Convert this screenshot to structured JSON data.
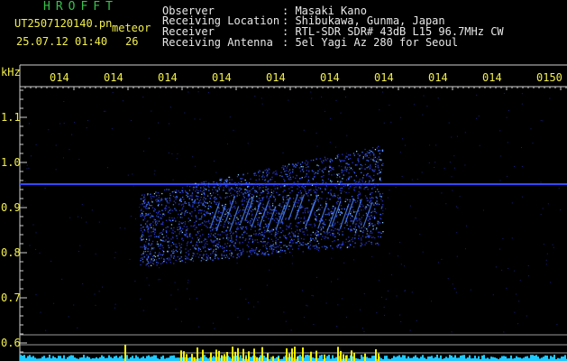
{
  "header": {
    "brand": "HROFFT",
    "filename": "UT2507120140.pn",
    "program_tag": "meteor",
    "timestamp": "25.07.12 01:40",
    "count": "26",
    "info_labels": [
      "Observer",
      "Receiving Location",
      "Receiver",
      "Receiving Antenna"
    ],
    "info_values": [
      ": Masaki Kano",
      ": Shibukawa, Gunma, Japan",
      ": RTL-SDR SDR# 43dB L15 96.7MHz CW",
      ": 5el Yagi Az 280 for Seoul"
    ]
  },
  "axes": {
    "y_unit": "kHz",
    "y_ticks": [
      "1.1",
      "1.0",
      "0.9",
      "0.8",
      "0.7",
      "0.6"
    ],
    "time_ticks": [
      "014",
      "014",
      "014",
      "014",
      "014",
      "014",
      "014",
      "014",
      "014",
      "0150"
    ]
  },
  "colors": {
    "background": "#000000",
    "text_white": "#e8e8e8",
    "text_yellow": "#f2ef4a",
    "brand_green": "#36c24a",
    "carrier": "#3348ff",
    "signal": "#3a6bff",
    "baseline_cyan": "#1fc8ff",
    "baseline_yellow": "#f5f000"
  }
}
